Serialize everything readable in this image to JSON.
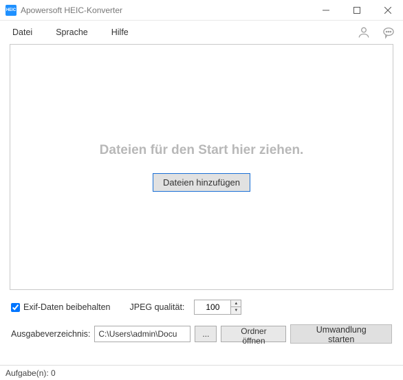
{
  "window": {
    "title": "Apowersoft HEIC-Konverter"
  },
  "menu": {
    "file": "Datei",
    "language": "Sprache",
    "help": "Hilfe"
  },
  "dropzone": {
    "hint": "Dateien für den Start hier ziehen.",
    "add_button": "Dateien hinzufügen"
  },
  "options": {
    "keep_exif": "Exif-Daten beibehalten",
    "keep_exif_checked": true,
    "quality_label": "JPEG qualität:",
    "quality_value": "100"
  },
  "output": {
    "label": "Ausgabeverzeichnis:",
    "path": "C:\\Users\\admin\\Docu",
    "browse": "...",
    "open_folder": "Ordner öffnen"
  },
  "actions": {
    "convert": "Umwandlung starten"
  },
  "status": {
    "tasks": "Aufgabe(n): 0"
  }
}
